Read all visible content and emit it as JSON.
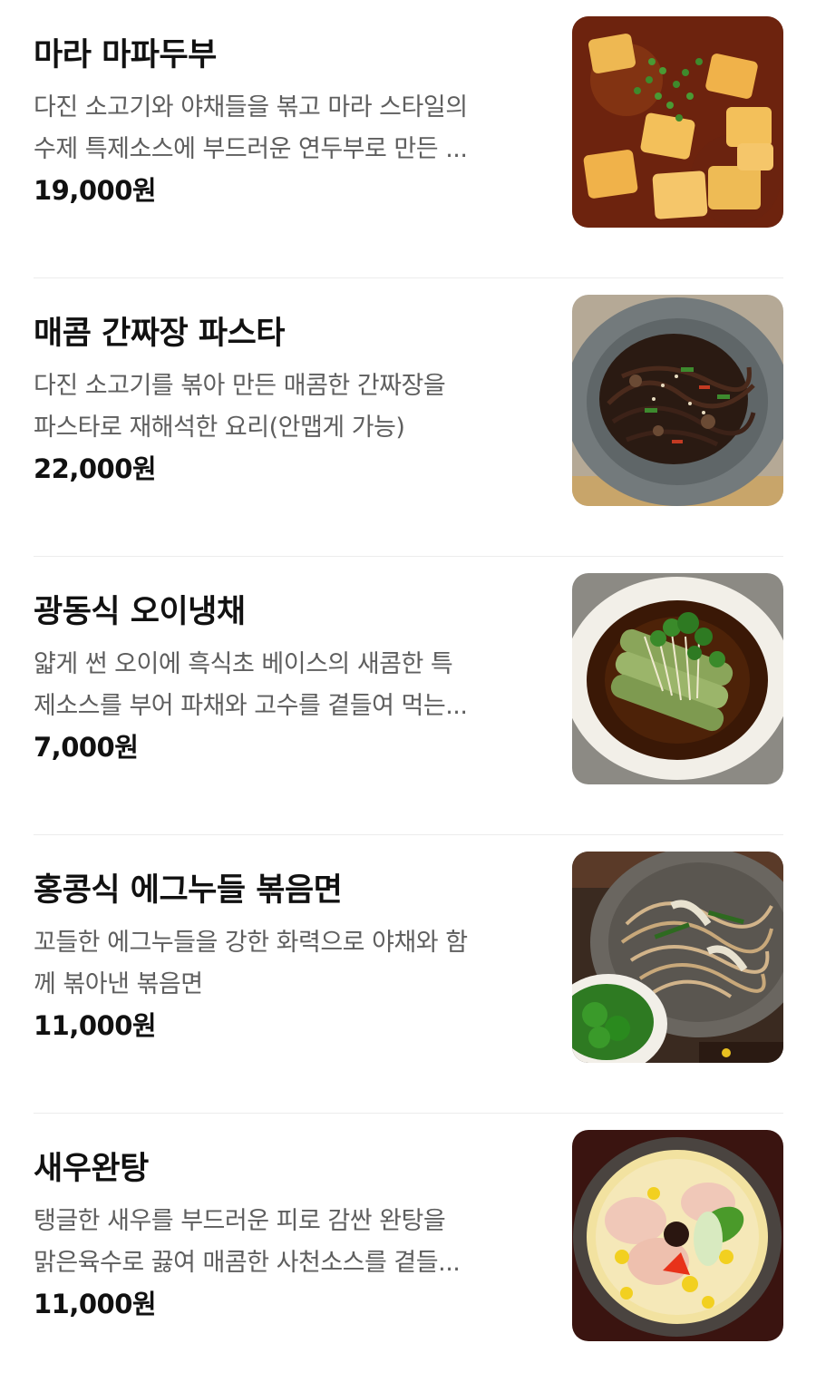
{
  "menu": {
    "items": [
      {
        "name": "마라 마파두부",
        "desc_line1": "다진 소고기와 야채들을 볶고 마라 스타일의",
        "desc_line2": "수제 특제소스에 부드러운 연두부로 만든 ...",
        "price": "19,000원"
      },
      {
        "name": "매콤 간짜장 파스타",
        "desc_line1": "다진 소고기를 볶아 만든 매콤한 간짜장을",
        "desc_line2": "파스타로 재해석한 요리(안맵게 가능)",
        "price": "22,000원"
      },
      {
        "name": "광동식 오이냉채",
        "desc_line1": "얇게 썬 오이에 흑식초 베이스의 새콤한 특",
        "desc_line2": "제소스를 부어 파채와 고수를 곁들여 먹는...",
        "price": "7,000원"
      },
      {
        "name": "홍콩식 에그누들 볶음면",
        "desc_line1": "꼬들한 에그누들을 강한 화력으로 야채와 함",
        "desc_line2": "께 볶아낸 볶음면",
        "price": "11,000원"
      },
      {
        "name": "새우완탕",
        "desc_line1": "탱글한 새우를 부드러운 피로 감싼 완탕을",
        "desc_line2": "맑은육수로 끓여 매콤한 사천소스를 곁들...",
        "price": "11,000원"
      }
    ]
  }
}
